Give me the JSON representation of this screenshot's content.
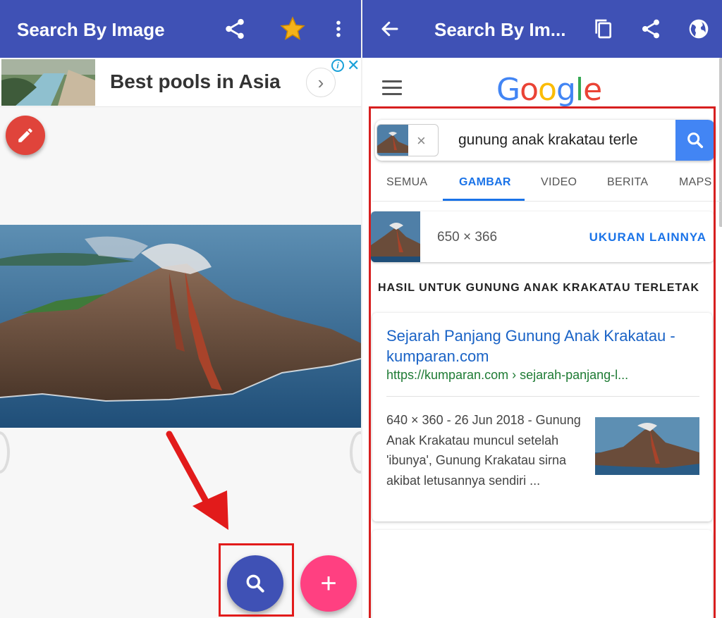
{
  "left_app": {
    "title": "Search By Image",
    "ad": {
      "title": "Best pools in Asia",
      "info_glyph": "i",
      "close_glyph": "✕",
      "chevron_glyph": "›"
    },
    "add_glyph": "+"
  },
  "right_app": {
    "title": "Search By Im...",
    "google_logo": [
      "G",
      "o",
      "o",
      "g",
      "l",
      "e"
    ],
    "search": {
      "query": "gunung anak krakatau terletak",
      "chip_close": "×"
    },
    "tabs": [
      "SEMUA",
      "GAMBAR",
      "VIDEO",
      "BERITA",
      "MAPS"
    ],
    "active_tab": "GAMBAR",
    "image_size": {
      "dims": "650 × 366",
      "more_label": "UKURAN LAINNYA"
    },
    "results_heading": "HASIL UNTUK GUNUNG ANAK KRAKATAU TERLETAK",
    "result": {
      "title": "Sejarah Panjang Gunung Anak Krakatau - kumparan.com",
      "url": "https://kumparan.com › sejarah-panjang-l...",
      "description": "640 × 360 - 26 Jun 2018 - Gunung Anak Krakatau muncul setelah 'ibunya', Gunung Krakatau sirna akibat letusannya sendiri ..."
    }
  },
  "colors": {
    "appbar": "#3f51b5",
    "search_fab": "#3f51b5",
    "add_fab": "#ff4081",
    "edit_fab": "#e0443b",
    "highlight": "#d71f1f",
    "link": "#1a63c6",
    "url": "#1e7b34"
  },
  "icons": {
    "left_toolbar": [
      "share-icon",
      "star-icon",
      "more-vert-icon"
    ],
    "right_toolbar": [
      "back-arrow-icon",
      "copy-icon",
      "share-icon",
      "globe-icon"
    ]
  }
}
